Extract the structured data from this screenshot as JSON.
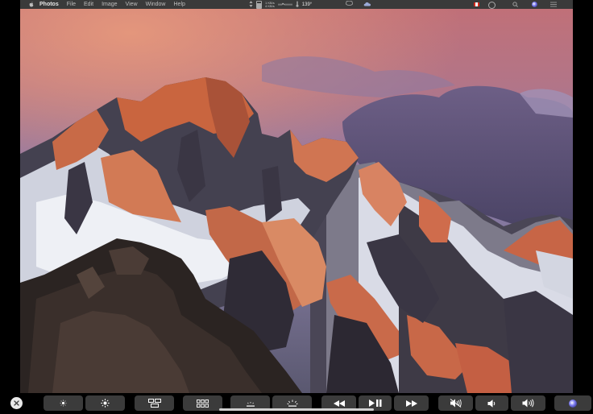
{
  "menubar": {
    "app_name": "Photos",
    "menus": [
      "File",
      "Edit",
      "Image",
      "View",
      "Window",
      "Help"
    ],
    "net_up": "1 KB/s",
    "net_down": "4 KB/s",
    "temperature": "139°"
  },
  "touchbar": {
    "buttons": [
      {
        "name": "brightness-down-button",
        "icon": "sun-small-icon"
      },
      {
        "name": "brightness-up-button",
        "icon": "sun-large-icon"
      },
      {
        "name": "mission-control-button",
        "icon": "mission-control-icon"
      },
      {
        "name": "launchpad-button",
        "icon": "launchpad-grid-icon"
      },
      {
        "name": "keyboard-brightness-down-button",
        "icon": "keyboard-light-down-icon"
      },
      {
        "name": "keyboard-brightness-up-button",
        "icon": "keyboard-light-up-icon"
      },
      {
        "name": "rewind-button",
        "icon": "rewind-icon"
      },
      {
        "name": "play-pause-button",
        "icon": "play-pause-icon"
      },
      {
        "name": "fast-forward-button",
        "icon": "fast-forward-icon"
      },
      {
        "name": "mute-button",
        "icon": "speaker-mute-icon"
      },
      {
        "name": "volume-down-button",
        "icon": "speaker-low-icon"
      },
      {
        "name": "volume-up-button",
        "icon": "speaker-high-icon"
      },
      {
        "name": "siri-button",
        "icon": "siri-icon"
      }
    ]
  },
  "colors": {
    "menubar_bg": "#3a3a3a",
    "touchbar_key": "#3b3b3b",
    "sky_top": "#c97a7a",
    "sky_purple": "#8a7aa5"
  }
}
